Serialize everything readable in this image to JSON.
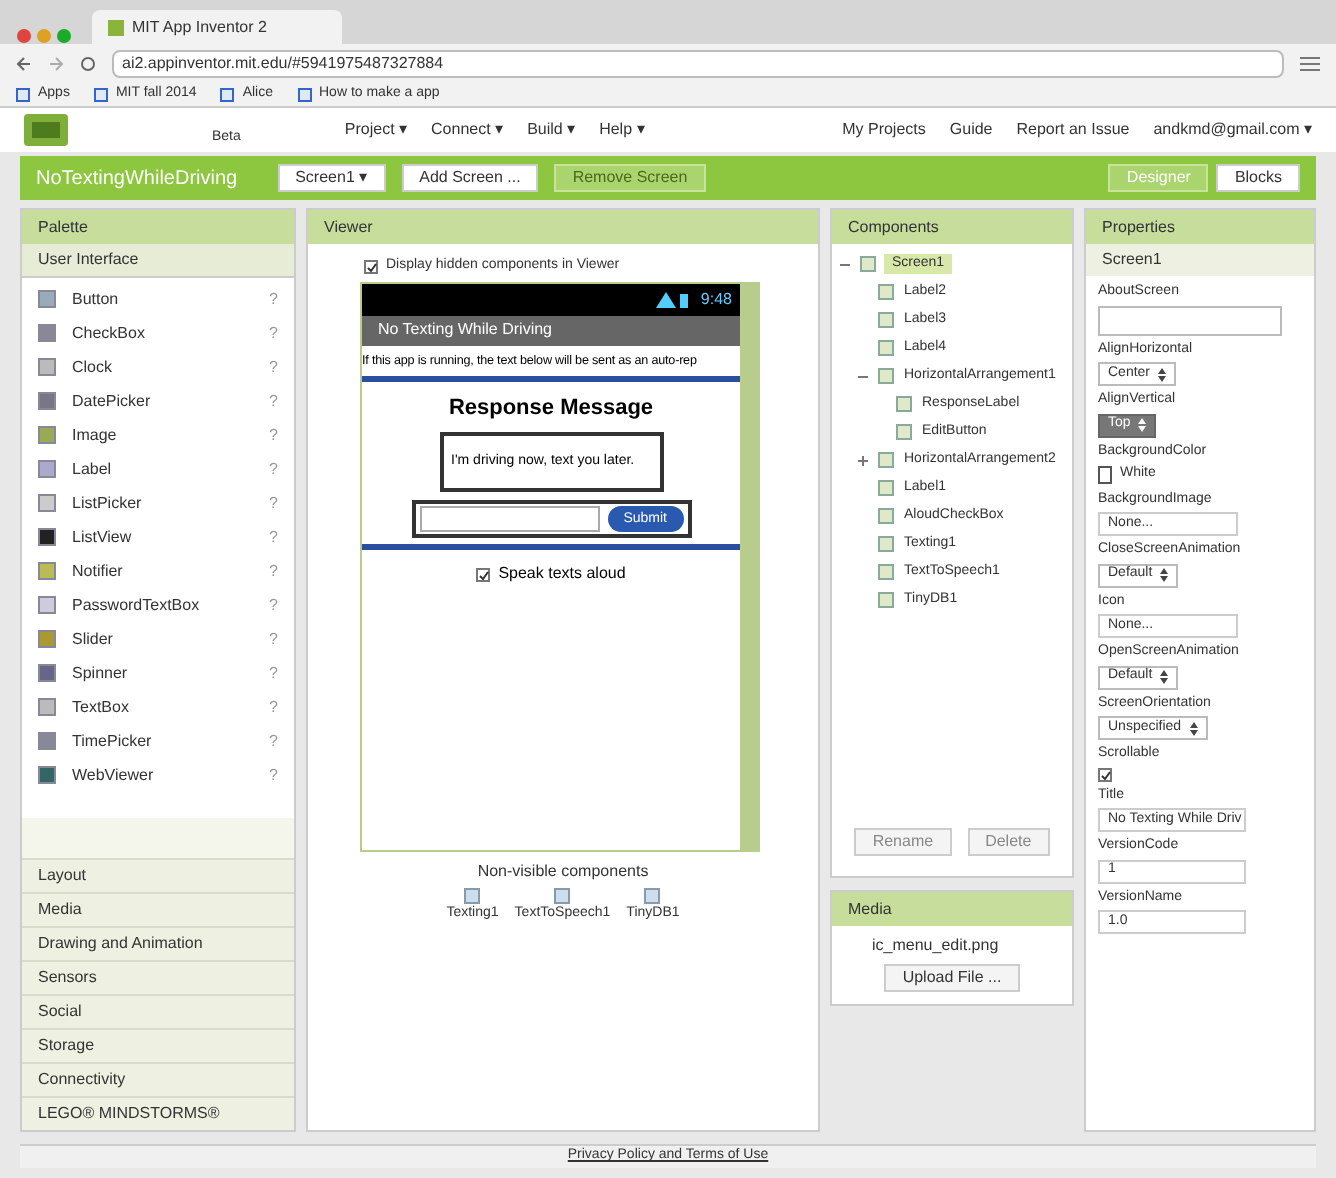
{
  "browser": {
    "tab_title": "MIT App Inventor 2",
    "url": "ai2.appinventor.mit.edu/#5941975487327884",
    "bookmarks": [
      {
        "label": "Apps"
      },
      {
        "label": "MIT fall 2014"
      },
      {
        "label": "Alice"
      },
      {
        "label": "How to make a app"
      }
    ]
  },
  "header": {
    "logo_text": "Beta",
    "menus": [
      "Project ▾",
      "Connect ▾",
      "Build ▾",
      "Help ▾"
    ],
    "links": [
      "My Projects",
      "Guide",
      "Report an Issue",
      "andkmd@gmail.com ▾"
    ]
  },
  "toolbar": {
    "project": "NoTextingWhileDriving",
    "buttons": [
      {
        "label": "Screen1 ▾",
        "disabled": false
      },
      {
        "label": "Add Screen ...",
        "disabled": false
      },
      {
        "label": "Remove Screen",
        "disabled": true
      }
    ],
    "modes": [
      {
        "label": "Designer",
        "selected": true
      },
      {
        "label": "Blocks",
        "selected": false
      }
    ]
  },
  "palette": {
    "title": "Palette",
    "group": "User Interface",
    "items": [
      {
        "name": "Button",
        "help": "?"
      },
      {
        "name": "CheckBox",
        "help": "?"
      },
      {
        "name": "Clock",
        "help": "?"
      },
      {
        "name": "DatePicker",
        "help": "?"
      },
      {
        "name": "Image",
        "help": "?"
      },
      {
        "name": "Label",
        "help": "?"
      },
      {
        "name": "ListPicker",
        "help": "?"
      },
      {
        "name": "ListView",
        "help": "?"
      },
      {
        "name": "Notifier",
        "help": "?"
      },
      {
        "name": "PasswordTextBox",
        "help": "?"
      },
      {
        "name": "Slider",
        "help": "?"
      },
      {
        "name": "Spinner",
        "help": "?"
      },
      {
        "name": "TextBox",
        "help": "?"
      },
      {
        "name": "TimePicker",
        "help": "?"
      },
      {
        "name": "WebViewer",
        "help": "?"
      }
    ],
    "categories": [
      "Layout",
      "Media",
      "Drawing and Animation",
      "Sensors",
      "Social",
      "Storage",
      "Connectivity",
      "LEGO® MINDSTORMS®"
    ]
  },
  "viewer": {
    "title": "Viewer",
    "hidden_toggle": {
      "label": "Display hidden components in Viewer",
      "checked": true
    },
    "phone": {
      "time": "9:48",
      "title": "No Texting While Driving",
      "intro": "If this app is running, the text below will be sent as an auto-rep",
      "heading": "Response Message",
      "response": "I'm driving now, text you later.",
      "submit": "Submit",
      "aloud": {
        "label": "Speak texts aloud",
        "checked": true
      }
    },
    "nonvisible_title": "Non-visible components",
    "nonvisible": [
      "Texting1",
      "TextToSpeech1",
      "TinyDB1"
    ]
  },
  "components": {
    "title": "Components",
    "tree": [
      {
        "name": "Screen1",
        "selected": true,
        "expanded": true,
        "children": [
          {
            "name": "Label2",
            "selected": false
          },
          {
            "name": "Label3",
            "selected": false
          },
          {
            "name": "Label4",
            "selected": false
          },
          {
            "name": "HorizontalArrangement1",
            "selected": false,
            "expanded": true,
            "children": [
              {
                "name": "ResponseLabel",
                "selected": false
              },
              {
                "name": "EditButton",
                "selected": false
              }
            ]
          },
          {
            "name": "HorizontalArrangement2",
            "selected": false,
            "expanded": false
          },
          {
            "name": "Label1",
            "selected": false
          },
          {
            "name": "AloudCheckBox",
            "selected": false
          },
          {
            "name": "Texting1",
            "selected": false
          },
          {
            "name": "TextToSpeech1",
            "selected": false
          },
          {
            "name": "TinyDB1",
            "selected": false
          }
        ]
      }
    ],
    "buttons": [
      "Rename",
      "Delete"
    ]
  },
  "media": {
    "title": "Media",
    "files": [
      "ic_menu_edit.png"
    ],
    "upload": "Upload File ..."
  },
  "properties": {
    "title": "Properties",
    "component": "Screen1",
    "items": [
      {
        "kind": "textarea",
        "label": "AboutScreen"
      },
      {
        "kind": "select",
        "label": "AlignHorizontal",
        "value": "Center",
        "disabled": false
      },
      {
        "kind": "select",
        "label": "AlignVertical",
        "value": "Top",
        "disabled": true
      },
      {
        "kind": "color",
        "label": "BackgroundColor",
        "value": "White",
        "color": "#ffffff"
      },
      {
        "kind": "picker",
        "label": "BackgroundImage",
        "value": "None..."
      },
      {
        "kind": "select",
        "label": "CloseScreenAnimation",
        "value": "Default",
        "disabled": false
      },
      {
        "kind": "picker",
        "label": "Icon",
        "value": "None..."
      },
      {
        "kind": "select",
        "label": "OpenScreenAnimation",
        "value": "Default",
        "disabled": false
      },
      {
        "kind": "select",
        "label": "ScreenOrientation",
        "value": "Unspecified",
        "disabled": false
      },
      {
        "kind": "checkbox",
        "label": "Scrollable",
        "checked": true
      },
      {
        "kind": "text",
        "label": "Title",
        "value": "No Texting While Driv"
      },
      {
        "kind": "text",
        "label": "VersionCode",
        "value": "1"
      },
      {
        "kind": "text",
        "label": "VersionName",
        "value": "1.0"
      }
    ]
  },
  "footer": "Privacy Policy and Terms of Use"
}
